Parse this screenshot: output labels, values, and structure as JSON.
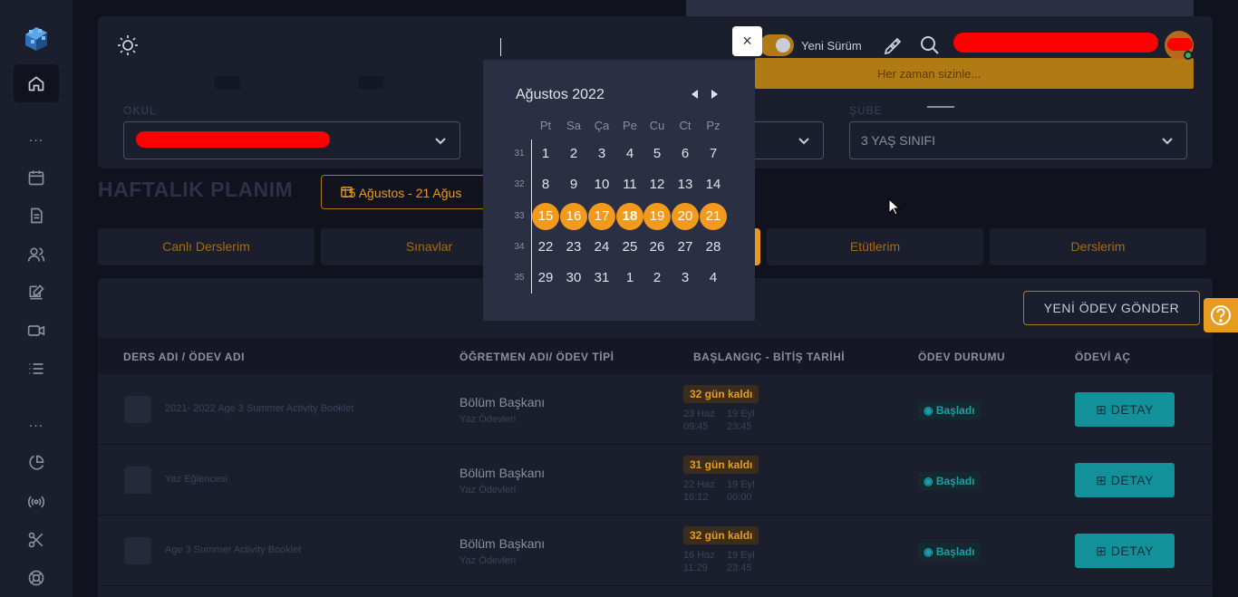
{
  "topbar": {
    "toggle_label": "Yeni Sürüm",
    "banner_text": "Her zaman sizinle..."
  },
  "sidebar": {
    "items": [
      "home-icon",
      "calendar-icon",
      "document-icon",
      "users-icon",
      "edit-icon",
      "video-icon",
      "list-icon",
      "pie-chart-icon",
      "broadcast-icon",
      "scissors-icon",
      "lifebuoy-icon"
    ],
    "dots": "..."
  },
  "filters": {
    "school_label": "OKUL",
    "branch_label": "ŞUBE",
    "branch_value": "3 YAŞ SINIFI"
  },
  "page": {
    "title": "HAFTALIK PLANIM",
    "week_range": "15 Ağustos - 21 Ağus"
  },
  "tabs": [
    "Canlı Derslerim",
    "Sınavlar",
    "Etütlerim",
    "Derslerim"
  ],
  "table": {
    "new_button": "YENİ ÖDEV GÖNDER",
    "headers": [
      "DERS ADI / ÖDEV ADI",
      "ÖĞRETMEN ADI/ ÖDEV TİPİ",
      "BAŞLANGIÇ - BİTİŞ TARİHİ",
      "ÖDEV DURUMU",
      "ÖDEVİ AÇ"
    ],
    "rows": [
      {
        "course": "2021- 2022 Age 3 Summer Activity Booklet",
        "teacher": "Bölüm Başkanı",
        "type": "Yaz Ödevleri",
        "days": "32 gün kaldı",
        "start_date": "23 Haz",
        "start_time": "09:45",
        "end_date": "19 Eyl",
        "end_time": "23:45",
        "status": "Başladı",
        "action": "DETAY"
      },
      {
        "course": "Yaz Eğlencesi",
        "teacher": "Bölüm Başkanı",
        "type": "Yaz Ödevleri",
        "days": "31 gün kaldı",
        "start_date": "22 Haz",
        "start_time": "16:12",
        "end_date": "19 Eyl",
        "end_time": "00:00",
        "status": "Başladı",
        "action": "DETAY"
      },
      {
        "course": "Age 3 Summer Activity Booklet",
        "teacher": "Bölüm Başkanı",
        "type": "Yaz Ödevleri",
        "days": "32 gün kaldı",
        "start_date": "16 Haz",
        "start_time": "11:29",
        "end_date": "19 Eyl",
        "end_time": "23:45",
        "status": "Başladı",
        "action": "DETAY"
      }
    ]
  },
  "datepicker": {
    "close": "×",
    "month": "Ağustos 2022",
    "weekdays": [
      "Pt",
      "Sa",
      "Ça",
      "Pe",
      "Cu",
      "Ct",
      "Pz"
    ],
    "weeks": [
      {
        "num": "31",
        "days": [
          "1",
          "2",
          "3",
          "4",
          "5",
          "6",
          "7"
        ]
      },
      {
        "num": "32",
        "days": [
          "8",
          "9",
          "10",
          "11",
          "12",
          "13",
          "14"
        ]
      },
      {
        "num": "33",
        "days": [
          "15",
          "16",
          "17",
          "18",
          "19",
          "20",
          "21"
        ]
      },
      {
        "num": "34",
        "days": [
          "22",
          "23",
          "24",
          "25",
          "26",
          "27",
          "28"
        ]
      },
      {
        "num": "35",
        "days": [
          "29",
          "30",
          "31",
          "1",
          "2",
          "3",
          "4"
        ]
      }
    ],
    "selected_week": "33",
    "today": "18"
  },
  "colors": {
    "accent": "#f39a1c",
    "teal": "#13919b",
    "background": "#10131d",
    "panel": "#1b1e2c"
  }
}
